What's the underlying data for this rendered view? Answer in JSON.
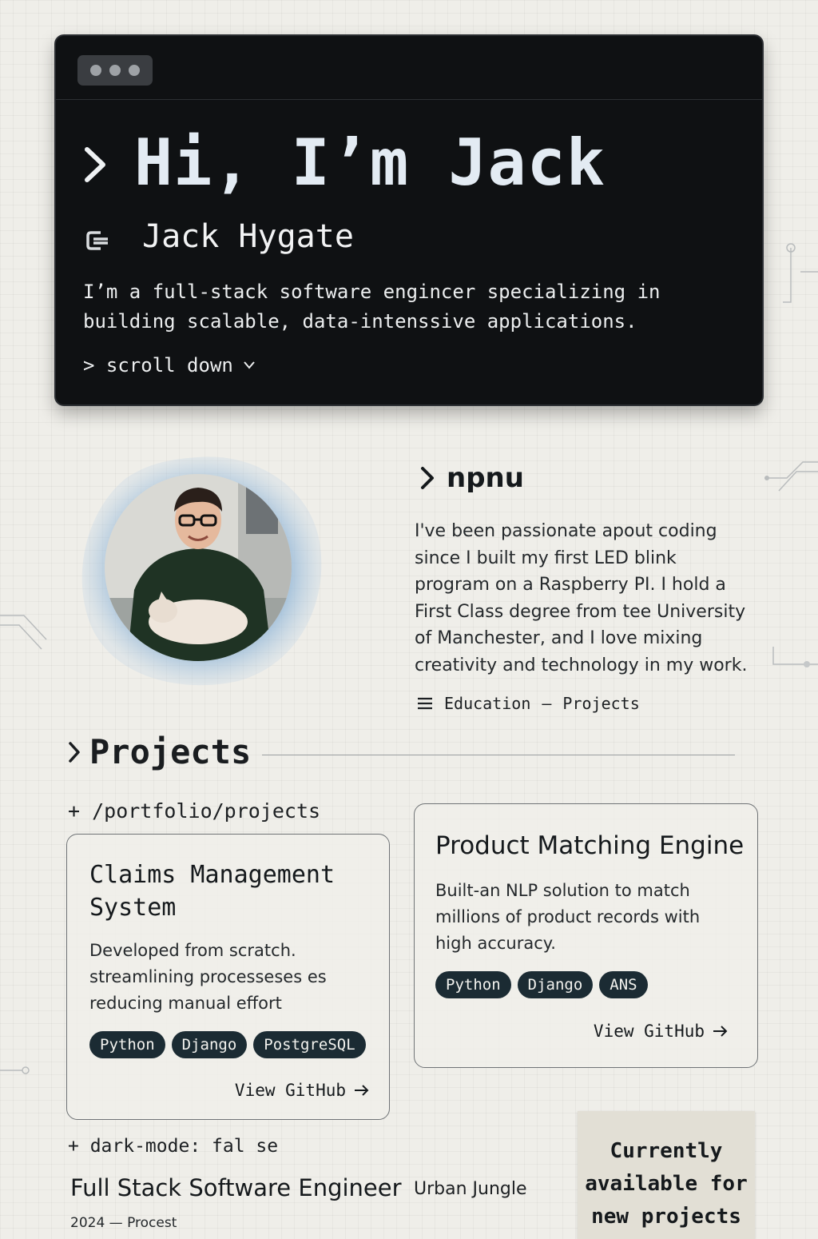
{
  "hero": {
    "title": "Hi, I’m Jack",
    "name": "Jack Hygate",
    "description": "I’m a full-stack software engincer specializing in building scalable, data-intenssive applications.",
    "scroll_label": "> scroll down"
  },
  "about": {
    "heading": "npnu",
    "text": "I've been passionate apout coding since I built my first LED blink program on a Raspberry PI. I hold a First Class degree from tee University of Manchester, and I love mixing creativity and technology in my work.",
    "links": [
      "Education",
      "Projects"
    ],
    "link_separator": "—"
  },
  "projects": {
    "heading": "Projects",
    "path": "+ /portfolio/projects",
    "items": [
      {
        "title": "Claims Management System",
        "description": "Developed from scratch. streamlining processeses es reducing manual effort",
        "tags": [
          "Python",
          "Django",
          "PostgreSQL"
        ],
        "link_label": "View GitHub"
      },
      {
        "title": "Product Matching Engine",
        "description": "Built-an NLP solution to match millions of product records with high accuracy.",
        "tags": [
          "Python",
          "Django",
          "ANS"
        ],
        "link_label": "View GitHub"
      }
    ]
  },
  "settings": {
    "dark_mode_line": "+ dark-mode: fal se"
  },
  "experience": {
    "role": "Full Stack Software Engineer",
    "company": "Urban Jungle",
    "dates": "2024 — Procest"
  },
  "availability": {
    "text": "Currently available for new projects"
  },
  "icons": [
    "chevron-right-icon",
    "terminal-prompt-icon",
    "chevron-down-icon",
    "menu-icon",
    "arrow-right-icon"
  ],
  "colors": {
    "terminal_bg": "#0f1113",
    "title_text": "#e3ebf3",
    "tag_bg": "#1b2b33",
    "page_bg": "#efeee9",
    "avatar_ring": "#8fb4d6"
  }
}
